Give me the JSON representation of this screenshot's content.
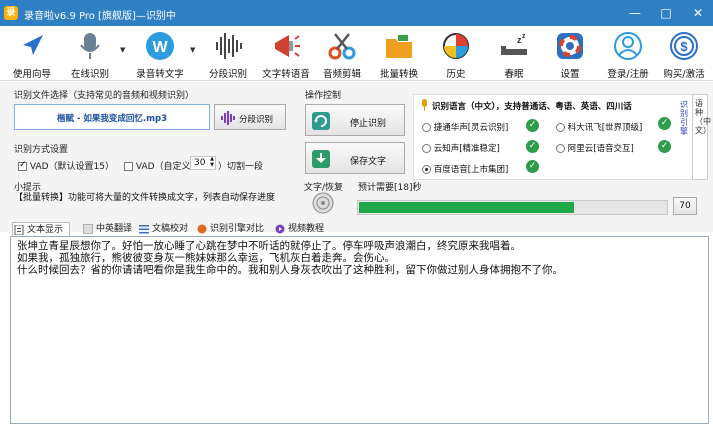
{
  "window": {
    "title": "录音啦v6.9 Pro [旗舰版]—识别中",
    "min": "—",
    "max": "□",
    "close": "✕"
  },
  "toolbar": [
    {
      "label": "使用向导",
      "icon": "compass-icon",
      "color": "#2a6fc9"
    },
    {
      "label": "在线识别",
      "icon": "microphone-icon",
      "color": "#6b7f95"
    },
    {
      "label": "录音转文字",
      "icon": "w-icon",
      "color": "#2d9be0"
    },
    {
      "label": "分段识别",
      "icon": "waveform-icon",
      "color": "#444"
    },
    {
      "label": "文字转语音",
      "icon": "megaphone-icon",
      "color": "#d04030"
    },
    {
      "label": "音频剪辑",
      "icon": "scissors-icon",
      "color": "#e05020"
    },
    {
      "label": "批量转换",
      "icon": "folder-icon",
      "color": "#f0a020"
    },
    {
      "label": "历史",
      "icon": "history-clock-icon",
      "color": "#e04030"
    },
    {
      "label": "春眠",
      "icon": "sleep-icon",
      "color": "#333"
    },
    {
      "label": "设置",
      "icon": "lifebuoy-icon",
      "color": "#e04030"
    },
    {
      "label": "登录/注册",
      "icon": "user-icon",
      "color": "#2d9be0"
    },
    {
      "label": "购买/激活",
      "icon": "dollar-icon",
      "color": "#2a6fc9"
    }
  ],
  "file_group": {
    "title": "识别文件选择（支持常见的音频和视频识别）",
    "filename": "楷赋 - 如果我变成回忆.mp3",
    "segment_btn": "分段识别"
  },
  "mode_group": {
    "title": "识别方式设置",
    "vad_default": "VAD（默认设置15）",
    "vad_custom": "VAD（自定义",
    "vad_value": "30",
    "cut_label": "）切割一段"
  },
  "tip": {
    "title": "小提示",
    "text": "【批量转换】功能可将大量的文件转换成文字，列表自动保存进度"
  },
  "ops": {
    "title": "操作控制",
    "stop": "停止识别",
    "save": "保存文字"
  },
  "lang": {
    "title": "识别语言（中文），支持普通话、粤语、英语、四川话",
    "options": [
      {
        "label": "捷通华声[灵云识别]",
        "selected": false
      },
      {
        "label": "科大讯飞[世界顶级]",
        "selected": false
      },
      {
        "label": "云知声[精准稳定]",
        "selected": false
      },
      {
        "label": "阿里云[语音交互]",
        "selected": false
      },
      {
        "label": "百度语音[上市集团]",
        "selected": true
      }
    ],
    "side": "语种（中文）",
    "side2": "识别引擎"
  },
  "progress": {
    "text_label": "文字/恢复",
    "estimate": "预计需要[18]秒",
    "percent": 70,
    "value_label": "70"
  },
  "tabs": [
    {
      "label": "文本显示",
      "icon": "doc-icon"
    },
    {
      "label": "中英翻译",
      "icon": "translate-icon"
    },
    {
      "label": "文稿校对",
      "icon": "list-icon"
    },
    {
      "label": "识别引擎对比",
      "icon": "compare-icon"
    },
    {
      "label": "视频教程",
      "icon": "video-icon"
    }
  ],
  "content": [
    "张坤立青星辰想你了。好怕一放心睡了心跳在梦中不听话的就停止了。停车呼吸声浪潮白，终究原来我唱着。",
    "如果我，孤独旅行，熊彼彼变身灰一熊妹妹那么幸运，飞机灰白着走奔。会伤心。",
    "什么时候回去？省的你请请吧看你是我生命中的。我和别人身灰衣吹出了这种胜利，留下你做过别人身体拥抱不了你。"
  ]
}
